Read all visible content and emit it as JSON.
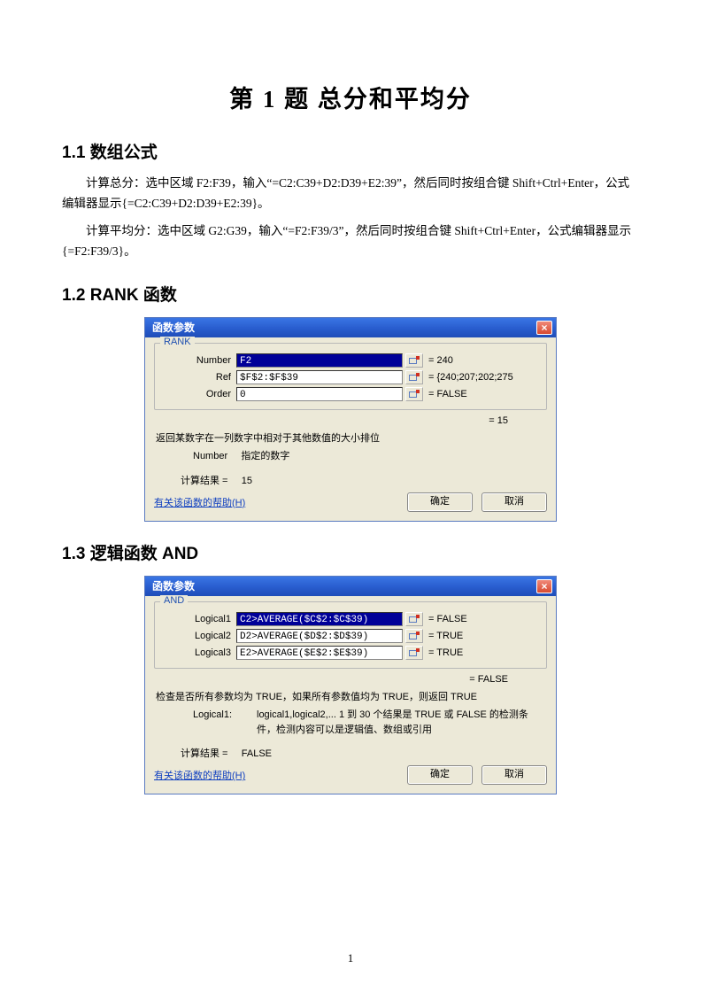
{
  "title": "第 1 题  总分和平均分",
  "sec11": "1.1 数组公式",
  "p1": "计算总分：选中区域 F2:F39，输入“=C2:C39+D2:D39+E2:39”，然后同时按组合键 Shift+Ctrl+Enter，公式编辑器显示{=C2:C39+D2:D39+E2:39}。",
  "p2": "计算平均分：选中区域 G2:G39，输入“=F2:F39/3”，然后同时按组合键 Shift+Ctrl+Enter，公式编辑器显示{=F2:F39/3}。",
  "sec12": "1.2 RANK 函数",
  "sec13": "1.3 逻辑函数 AND",
  "dlgTitle": "函数参数",
  "rank": {
    "name": "RANK",
    "labels": {
      "number": "Number",
      "ref": "Ref",
      "order": "Order"
    },
    "vals": {
      "number": "F2",
      "ref": "$F$2:$F$39",
      "order": "0"
    },
    "res": {
      "number": "= 240",
      "ref": "= {240;207;202;275",
      "order": "= FALSE",
      "overall": "= 15"
    },
    "desc1": "返回某数字在一列数字中相对于其他数值的大小排位",
    "desc2a": "Number",
    "desc2b": "指定的数字",
    "resultLabel": "计算结果 =",
    "resultVal": "15"
  },
  "and": {
    "name": "AND",
    "labels": {
      "l1": "Logical1",
      "l2": "Logical2",
      "l3": "Logical3"
    },
    "vals": {
      "l1": "C2>AVERAGE($C$2:$C$39)",
      "l2": "D2>AVERAGE($D$2:$D$39)",
      "l3": "E2>AVERAGE($E$2:$E$39)"
    },
    "res": {
      "l1": "= FALSE",
      "l2": "= TRUE",
      "l3": "= TRUE",
      "overall": "= FALSE"
    },
    "desc1": "检查是否所有参数均为 TRUE，如果所有参数值均为 TRUE，则返回 TRUE",
    "desc2a": "Logical1:",
    "desc2b": "logical1,logical2,... 1 到 30 个结果是 TRUE 或 FALSE 的检测条件，检测内容可以是逻辑值、数组或引用",
    "resultLabel": "计算结果 =",
    "resultVal": "FALSE"
  },
  "helpLink": "有关该函数的帮助(H)",
  "ok": "确定",
  "cancel": "取消",
  "pageNo": "1"
}
